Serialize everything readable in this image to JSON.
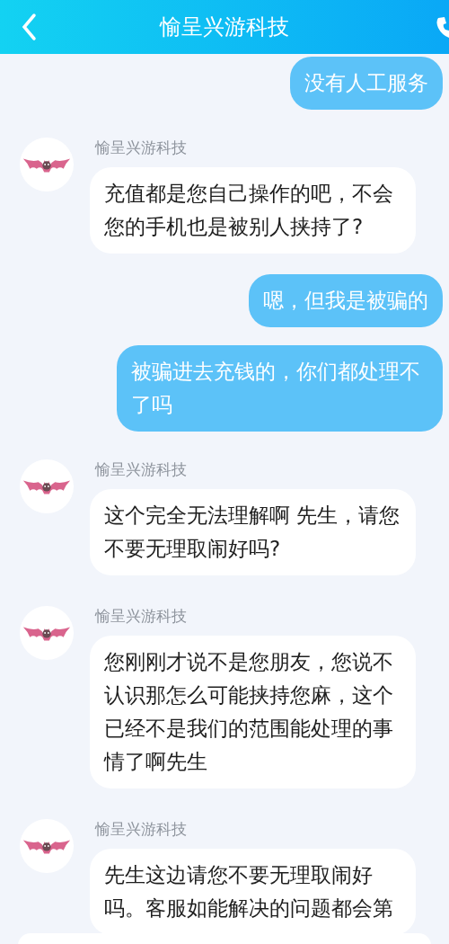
{
  "header": {
    "title": "愉呈兴游科技"
  },
  "messages": [
    {
      "kind": "sent",
      "text": "没有人工服务"
    },
    {
      "kind": "received",
      "sender": "愉呈兴游科技",
      "text": "充值都是您自己操作的吧，不会您的手机也是被别人挟持了?"
    },
    {
      "kind": "sent",
      "text": "嗯，但我是被骗的"
    },
    {
      "kind": "sent",
      "text": "被骗进去充钱的，你们都处理不了吗"
    },
    {
      "kind": "received",
      "sender": "愉呈兴游科技",
      "text": "这个完全无法理解啊 先生，请您不要无理取闹好吗?"
    },
    {
      "kind": "received",
      "sender": "愉呈兴游科技",
      "text": "您刚刚才说不是您朋友，您说不认识那怎么可能挟持您麻，这个已经不是我们的范围能处理的事情了啊先生"
    },
    {
      "kind": "received",
      "sender": "愉呈兴游科技",
      "text": "先生这边请您不要无理取闹好吗。客服如能解决的问题都会第"
    }
  ]
}
